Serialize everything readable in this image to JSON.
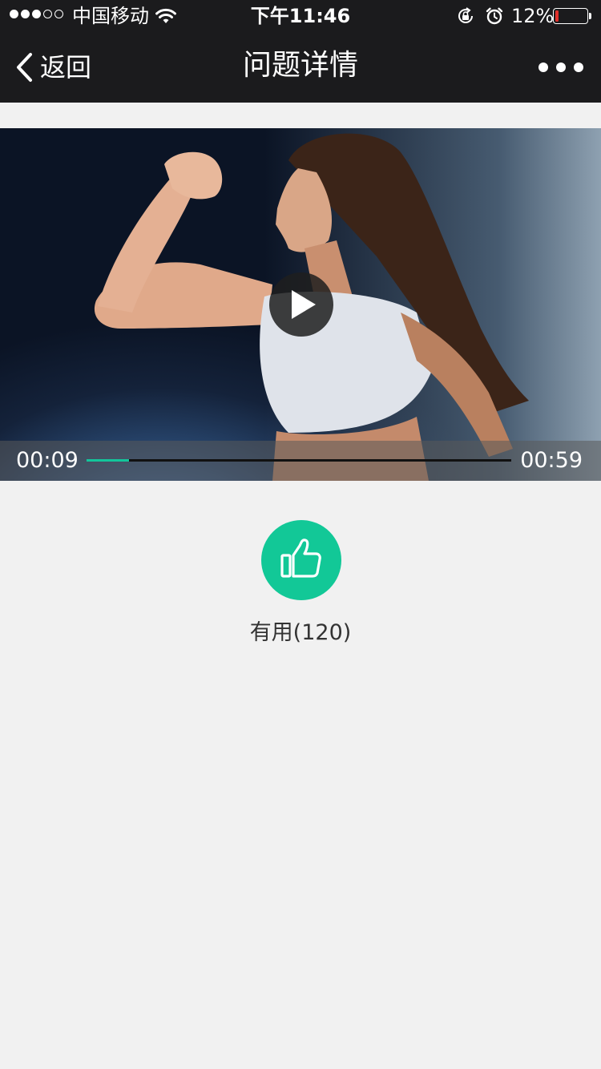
{
  "status_bar": {
    "carrier": "中国移动",
    "time": "下午11:46",
    "battery_percent_label": "12%",
    "battery_level": 0.12,
    "signal_bars_filled": 3,
    "signal_bars_total": 5
  },
  "nav": {
    "back_label": "返回",
    "title": "问题详情"
  },
  "video": {
    "current_time": "00:09",
    "total_time": "00:59",
    "progress": 0.1
  },
  "like": {
    "label": "有用(120)"
  },
  "colors": {
    "accent": "#12c897",
    "nav_bg": "#1b1b1d",
    "page_bg": "#f1f1f1",
    "battery_low": "#e0302b"
  }
}
